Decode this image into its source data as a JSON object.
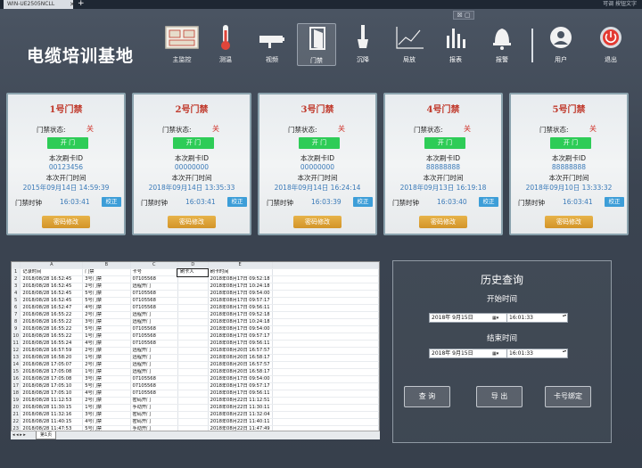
{
  "browser": {
    "tab_label": "WIN-UE2505NCLL",
    "tab_close": "✕",
    "new_tab": "+",
    "right_info": "可调 按钮文字",
    "ctrl_label": "☒ ▢"
  },
  "app": {
    "title": "电缆培训基地"
  },
  "nav": {
    "items": [
      {
        "label": "主监控"
      },
      {
        "label": "测温"
      },
      {
        "label": "视频"
      },
      {
        "label": "门禁"
      },
      {
        "label": "沉降"
      },
      {
        "label": "局放"
      },
      {
        "label": "报表"
      },
      {
        "label": "报警"
      },
      {
        "label": "用户"
      },
      {
        "label": "退出"
      }
    ],
    "active": "门禁"
  },
  "door_labels": {
    "status": "门禁状态:",
    "open_button": "开  门",
    "card_id_label": "本次刷卡ID",
    "open_time_label": "本次开门时间",
    "clock_label": "门禁时钟",
    "calibrate": "校正",
    "password": "密码修改"
  },
  "doors": [
    {
      "title": "1号门禁",
      "status": "关",
      "card_id": "00123456",
      "open_time": "2015年09月14日 14:59:39",
      "clock": "16:03:41"
    },
    {
      "title": "2号门禁",
      "status": "关",
      "card_id": "00000000",
      "open_time": "2018年09月14日 13:35:33",
      "clock": "16:03:41"
    },
    {
      "title": "3号门禁",
      "status": "关",
      "card_id": "00000000",
      "open_time": "2018年09月14日 16:24:14",
      "clock": "16:03:39"
    },
    {
      "title": "4号门禁",
      "status": "关",
      "card_id": "88888888",
      "open_time": "2018年09月13日 16:19:18",
      "clock": "16:03:40"
    },
    {
      "title": "5号门禁",
      "status": "关",
      "card_id": "88888888",
      "open_time": "2018年09月10日 13:33:32",
      "clock": "16:03:41"
    }
  ],
  "sheet": {
    "col_letters": [
      "A",
      "B",
      "C",
      "D",
      "E"
    ],
    "headers": [
      "记录时间",
      "门禁",
      "卡号",
      "刷卡人",
      "刷卡时间"
    ],
    "rows": [
      [
        "2018/08/28 16:52:45",
        "3号门禁",
        "07105568",
        "",
        "2018年08月17日 09:52:18"
      ],
      [
        "2018/08/28 16:52:45",
        "2号门禁",
        "远程开门",
        "",
        "2018年08月17日 10:24:18"
      ],
      [
        "2018/08/28 16:52:45",
        "5号门禁",
        "07105568",
        "",
        "2018年08月17日 09:54:00"
      ],
      [
        "2018/08/28 16:52:45",
        "5号门禁",
        "07105568",
        "",
        "2018年08月17日 09:57:17"
      ],
      [
        "2018/08/28 16:52:47",
        "4号门禁",
        "07105568",
        "",
        "2018年08月17日 09:56:11"
      ],
      [
        "2018/08/28 16:55:22",
        "2号门禁",
        "远程开门",
        "",
        "2018年08月17日 09:52:18"
      ],
      [
        "2018/08/28 16:55:22",
        "3号门禁",
        "远程开门",
        "",
        "2018年08月17日 10:24:18"
      ],
      [
        "2018/08/28 16:55:22",
        "5号门禁",
        "07105568",
        "",
        "2018年08月17日 09:54:00"
      ],
      [
        "2018/08/28 16:55:22",
        "1号门禁",
        "07105568",
        "",
        "2018年08月17日 09:57:17"
      ],
      [
        "2018/08/28 16:55:24",
        "4号门禁",
        "07105568",
        "",
        "2018年08月17日 09:56:11"
      ],
      [
        "2018/08/28 16:57:59",
        "2号门禁",
        "远程开门",
        "",
        "2018年08月20日 16:57:57"
      ],
      [
        "2018/08/28 16:58:20",
        "1号门禁",
        "远程开门",
        "",
        "2018年08月20日 16:58:17"
      ],
      [
        "2018/08/28 17:05:07",
        "2号门禁",
        "远程开门",
        "",
        "2018年08月20日 16:57:57"
      ],
      [
        "2018/08/28 17:05:08",
        "1号门禁",
        "远程开门",
        "",
        "2018年08月20日 16:58:17"
      ],
      [
        "2018/08/28 17:05:08",
        "3号门禁",
        "07105568",
        "",
        "2018年08月17日 09:54:00"
      ],
      [
        "2018/08/28 17:05:10",
        "5号门禁",
        "07105568",
        "",
        "2018年08月17日 09:57:17"
      ],
      [
        "2018/08/28 17:05:10",
        "4号门禁",
        "07105568",
        "",
        "2018年08月17日 09:56:11"
      ],
      [
        "2018/08/28 11:12:53",
        "2号门禁",
        "密码开门",
        "",
        "2018年08月22日 11:12:51"
      ],
      [
        "2018/08/28 11:30:15",
        "1号门禁",
        "手动开门",
        "",
        "2018年08月22日 11:30:11"
      ],
      [
        "2018/08/28 11:32:16",
        "3号门禁",
        "密码开门",
        "",
        "2018年08月22日 11:32:04"
      ],
      [
        "2018/08/28 11:40:15",
        "4号门禁",
        "密码开门",
        "",
        "2018年08月22日 11:40:11"
      ],
      [
        "2018/08/28 11:47:53",
        "5号门禁",
        "手动开门",
        "",
        "2018年08月22日 11:47:49"
      ],
      [
        "2018/08/28 16:03:10",
        "1号门禁",
        "手动开门",
        "",
        "2018年08月28日 16:03:08"
      ]
    ],
    "tab_name": "第1页",
    "nav": "◂ ◂ ▸ ▸"
  },
  "history": {
    "title": "历史查询",
    "start_label": "开始时间",
    "end_label": "结束时间",
    "start_date": "2018年 9月15日",
    "start_time": "16:01:33",
    "end_date": "2018年 9月15日",
    "end_time": "16:01:33",
    "date_dropdown": "▦▾",
    "spin": "▴▾",
    "query_button": "查 询",
    "export_button": "导 出",
    "bind_button": "卡号绑定"
  },
  "colors": {
    "background": "#3b4451",
    "accent_red": "#c0392b",
    "open_green": "#2ecc57",
    "calibrate_blue": "#3d9ed8",
    "password_orange": "#d39428",
    "value_blue": "#3a7ab8"
  }
}
